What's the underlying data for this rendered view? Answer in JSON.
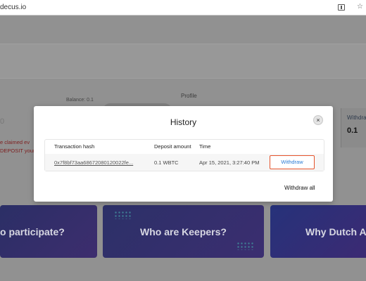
{
  "browser": {
    "url": "decus.io"
  },
  "background": {
    "balance_label": "Balance: 0.1",
    "input_value": "0",
    "profile_label": "Profile",
    "warning_line1": "e claimed ev",
    "warning_line2": "DEPOSIT your",
    "withdraw_card_label": "Withdra",
    "withdraw_card_value": "0.1",
    "cards": [
      {
        "label": "o participate?"
      },
      {
        "label": "Who are Keepers?"
      },
      {
        "label": "Why Dutch Au"
      }
    ]
  },
  "modal": {
    "title": "History",
    "close_symbol": "×",
    "columns": [
      "Transaction hash",
      "Deposit amount",
      "Time"
    ],
    "rows": [
      {
        "hash": "0x7f8bf73aa68672080120022fe...",
        "amount": "0.1 WBTC",
        "time": "Apr 15, 2021, 3:27:40 PM",
        "action": "Withdraw"
      }
    ],
    "withdraw_all_label": "Withdraw all"
  },
  "colors": {
    "withdraw_border": "#e5532b",
    "withdraw_text": "#2a7bd4",
    "card_bg": "#2c3068"
  }
}
